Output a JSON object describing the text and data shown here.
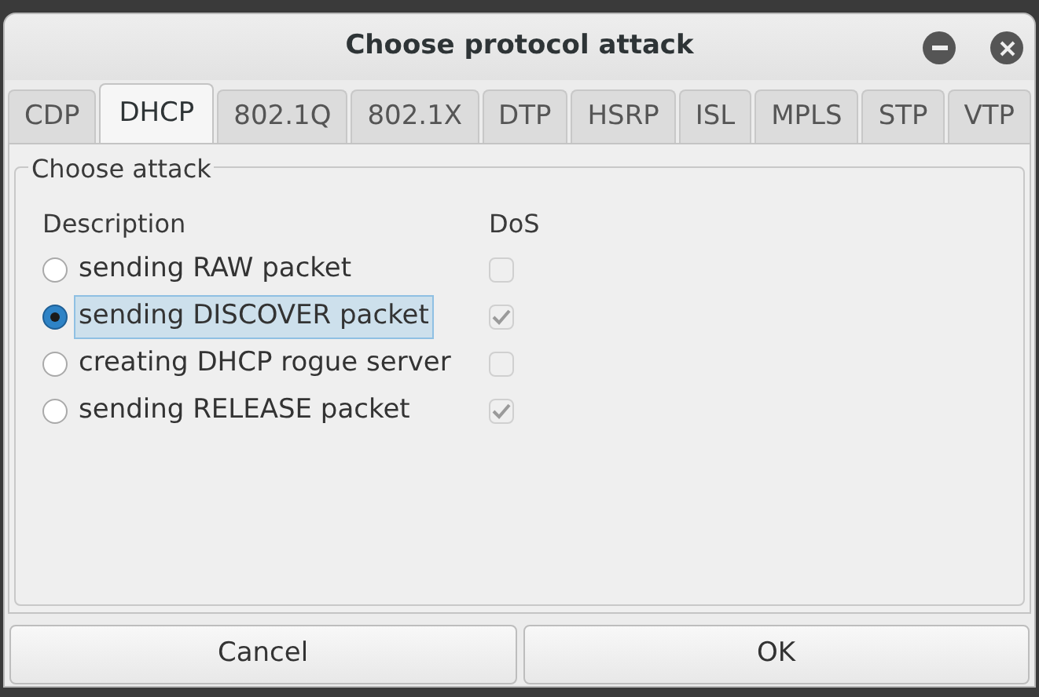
{
  "window": {
    "title": "Choose protocol attack"
  },
  "tabs": [
    {
      "label": "CDP",
      "selected": false
    },
    {
      "label": "DHCP",
      "selected": true
    },
    {
      "label": "802.1Q",
      "selected": false
    },
    {
      "label": "802.1X",
      "selected": false
    },
    {
      "label": "DTP",
      "selected": false
    },
    {
      "label": "HSRP",
      "selected": false
    },
    {
      "label": "ISL",
      "selected": false
    },
    {
      "label": "MPLS",
      "selected": false
    },
    {
      "label": "STP",
      "selected": false
    },
    {
      "label": "VTP",
      "selected": false
    }
  ],
  "group": {
    "title": "Choose attack",
    "columns": [
      "Description",
      "DoS"
    ],
    "attacks": [
      {
        "description": "sending RAW packet",
        "selected": false,
        "dos": false
      },
      {
        "description": "sending DISCOVER packet",
        "selected": true,
        "dos": true
      },
      {
        "description": "creating DHCP rogue server",
        "selected": false,
        "dos": false
      },
      {
        "description": "sending RELEASE packet",
        "selected": false,
        "dos": true
      }
    ]
  },
  "buttons": [
    "Cancel",
    "OK"
  ]
}
